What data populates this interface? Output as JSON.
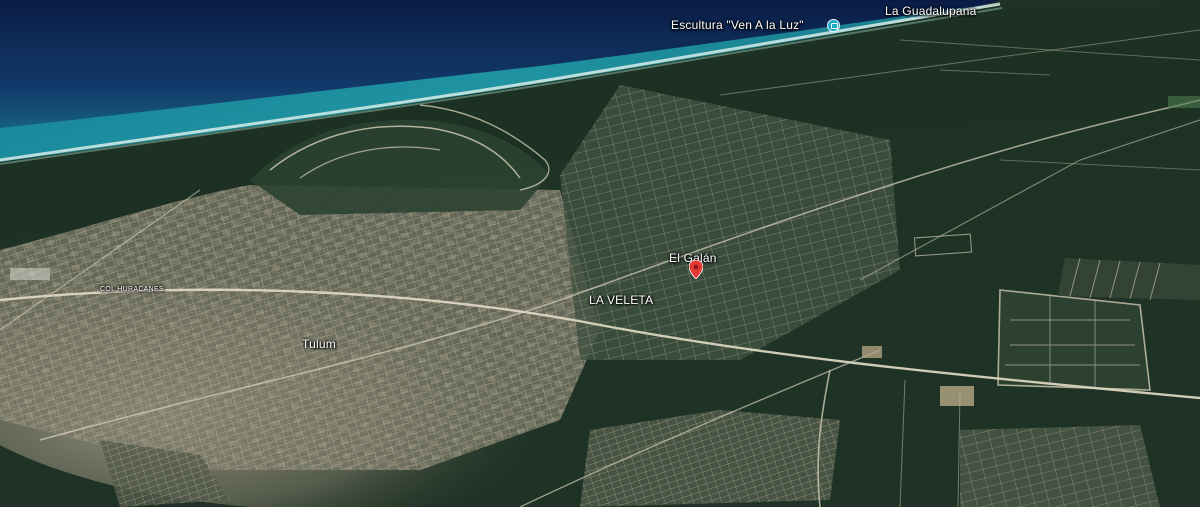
{
  "map": {
    "view": "satellite-3d",
    "colors": {
      "ocean_deep": "#0d2350",
      "ocean_shallow": "#1a8a9a",
      "beach": "#cfe3e0",
      "jungle": "#1e3326",
      "urban": "#8c8a78",
      "road": "#d8d2bc",
      "pin": "#e53935",
      "poi": "#20a8c8"
    }
  },
  "labels": {
    "escultura": "Escultura \"Ven A la Luz\"",
    "guadalupana": "La Guadalupana",
    "el_galan": "El Galán",
    "la_veleta": "LA VELETA",
    "tulum": "Tulum",
    "huracanes": "COL HURACANES"
  },
  "icons": {
    "poi": "camera-icon",
    "marker": "map-pin-icon"
  }
}
